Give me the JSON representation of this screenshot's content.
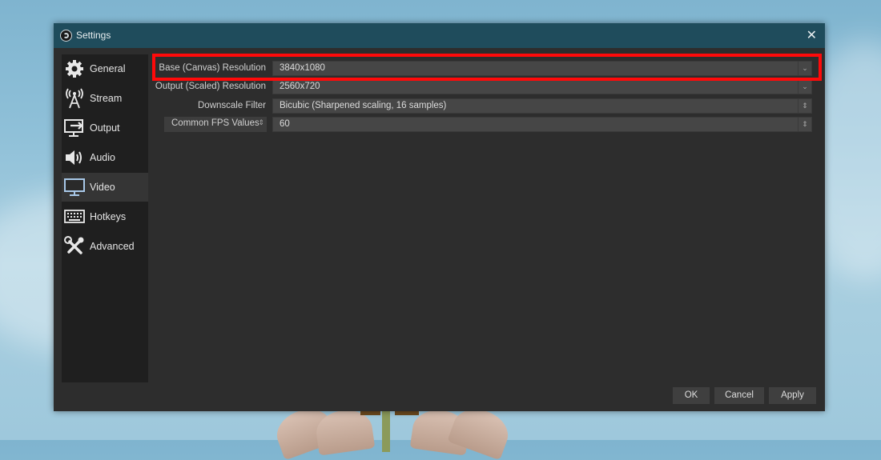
{
  "window": {
    "title": "Settings",
    "close_icon": "close-icon",
    "logo_icon": "obs-logo-icon"
  },
  "sidebar": {
    "items": [
      {
        "label": "General",
        "icon": "gear-icon",
        "active": false
      },
      {
        "label": "Stream",
        "icon": "antenna-icon",
        "active": false
      },
      {
        "label": "Output",
        "icon": "monitor-output-icon",
        "active": false
      },
      {
        "label": "Audio",
        "icon": "speaker-icon",
        "active": false
      },
      {
        "label": "Video",
        "icon": "monitor-icon",
        "active": true
      },
      {
        "label": "Hotkeys",
        "icon": "keyboard-icon",
        "active": false
      },
      {
        "label": "Advanced",
        "icon": "tools-icon",
        "active": false
      }
    ]
  },
  "video": {
    "base_resolution": {
      "label": "Base (Canvas) Resolution",
      "value": "3840x1080"
    },
    "output_resolution": {
      "label": "Output (Scaled) Resolution",
      "value": "2560x720"
    },
    "downscale_filter": {
      "label": "Downscale Filter",
      "value": "Bicubic (Sharpened scaling, 16 samples)"
    },
    "fps": {
      "label": "Common FPS Values",
      "value": "60"
    }
  },
  "buttons": {
    "ok": "OK",
    "cancel": "Cancel",
    "apply": "Apply"
  },
  "colors": {
    "titlebar": "#1f4c5c",
    "highlight": "#ff0a0a"
  }
}
